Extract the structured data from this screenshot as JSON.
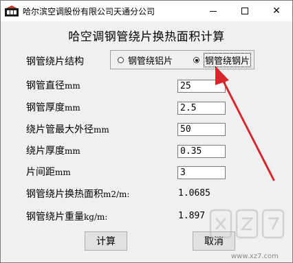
{
  "window": {
    "title": "哈尔滨空调股份有限公司天通分公司",
    "app_icon": "company-logo-icon",
    "controls": {
      "minimize": "minimize-icon",
      "maximize": "maximize-icon",
      "close_glyph": "✕"
    }
  },
  "form": {
    "heading": "哈空调钢管绕片换热面积计算",
    "structure": {
      "label": "钢管绕片结构",
      "options": [
        {
          "label": "钢管绕铝片",
          "selected": false
        },
        {
          "label": "钢管绕钢片",
          "selected": true
        }
      ]
    },
    "fields": [
      {
        "label": "钢管直径",
        "unit": "mm",
        "value": "25"
      },
      {
        "label": "钢管厚度",
        "unit": "mm",
        "value": "2.5"
      },
      {
        "label": "绕片管最大外径",
        "unit": "mm",
        "value": "50"
      },
      {
        "label": "绕片厚度",
        "unit": "mm",
        "value": "0.35"
      },
      {
        "label": "片间距",
        "unit": "mm",
        "value": "3"
      }
    ],
    "results": [
      {
        "label": "钢管绕片换热面积",
        "unit": "m2/m:",
        "value": "1.0685"
      },
      {
        "label": "钢管绕片重量",
        "unit": "kg/m:",
        "value": "1.897"
      }
    ],
    "buttons": {
      "calculate": "计算",
      "cancel": "取消"
    }
  },
  "annotation": {
    "arrow_color": "#d9262b"
  },
  "watermark": {
    "text": "www.xz7.com"
  }
}
